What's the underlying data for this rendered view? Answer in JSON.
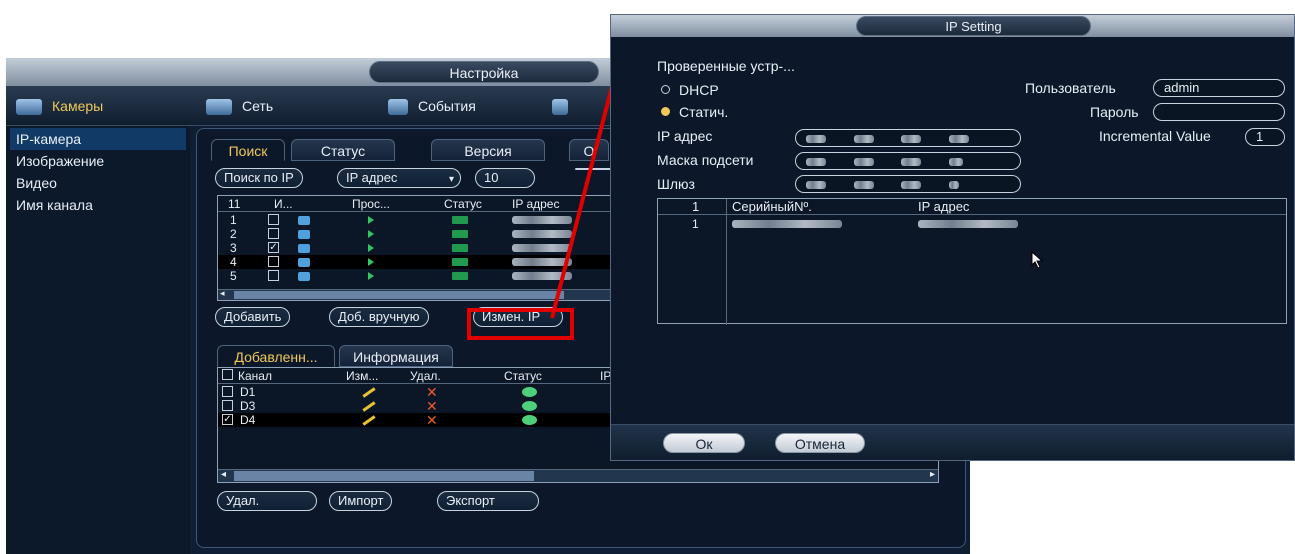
{
  "main": {
    "title": "Настройка",
    "nav": {
      "cameras": "Камеры",
      "network": "Сеть",
      "events": "События"
    },
    "sidebar": [
      "IP-камера",
      "Изображение",
      "Видео",
      "Имя канала"
    ],
    "tabs": [
      "Поиск",
      "Статус",
      "Версия",
      "О"
    ],
    "search": {
      "button": "Поиск по IP",
      "filter": "IP адрес",
      "count": "10"
    },
    "found": {
      "headers": [
        "11",
        "И...",
        "Прос...",
        "Статус",
        "IP адрес"
      ],
      "rows": [
        {
          "n": "1",
          "checked": false
        },
        {
          "n": "2",
          "checked": false
        },
        {
          "n": "3",
          "checked": true
        },
        {
          "n": "4",
          "checked": false
        },
        {
          "n": "5",
          "checked": false
        }
      ]
    },
    "actions": {
      "add": "Добавить",
      "manual": "Доб. вручную",
      "change_ip": "Измен. IP"
    },
    "lower_tabs": [
      "Добавленн...",
      "Информация"
    ],
    "added": {
      "headers": [
        "Канал",
        "Изм...",
        "Удал.",
        "Статус",
        "IP"
      ],
      "rows": [
        {
          "ch": "D1",
          "checked": false
        },
        {
          "ch": "D3",
          "checked": false
        },
        {
          "ch": "D4",
          "checked": true
        }
      ]
    },
    "bottom": {
      "delete": "Удал.",
      "import": "Импорт",
      "export": "Экспорт"
    }
  },
  "dialog": {
    "title": "IP Setting",
    "verified": "Проверенные устр-...",
    "dhcp": "DHCP",
    "static": "Статич.",
    "ip_label": "IP адрес",
    "mask_label": "Маска подсети",
    "gateway_label": "Шлюз",
    "user_label": "Пользователь",
    "user_value": "admin",
    "password_label": "Пароль",
    "increment_label": "Incremental Value",
    "increment_value": "1",
    "table": {
      "headers": [
        "1",
        "СерийныйNº.",
        "IP адрес"
      ],
      "rows": [
        {
          "n": "1"
        }
      ]
    },
    "ok": "Ок",
    "cancel": "Отмена"
  },
  "colors": {
    "accent": "#f0c85a",
    "panel": "#0c1829",
    "highlight": "#e10000"
  }
}
